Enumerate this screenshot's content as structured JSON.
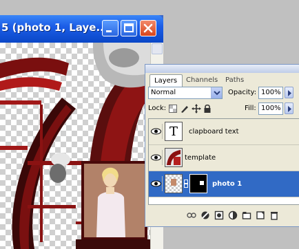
{
  "document": {
    "title": "5 (photo 1, Laye..."
  },
  "layers_panel": {
    "tabs": [
      "Layers",
      "Channels",
      "Paths"
    ],
    "blend_mode": "Normal",
    "opacity_label": "Opacity:",
    "opacity_value": "100%",
    "lock_label": "Lock:",
    "fill_label": "Fill:",
    "fill_value": "100%",
    "layers": [
      {
        "name": "clapboard text",
        "selected": false
      },
      {
        "name": "template",
        "selected": false
      },
      {
        "name": "photo 1",
        "selected": true
      }
    ],
    "text_layer_glyph": "T"
  },
  "colors": {
    "accent": "#316ac5",
    "titlebar": "#0a47c7",
    "close_button": "#d8451d"
  }
}
